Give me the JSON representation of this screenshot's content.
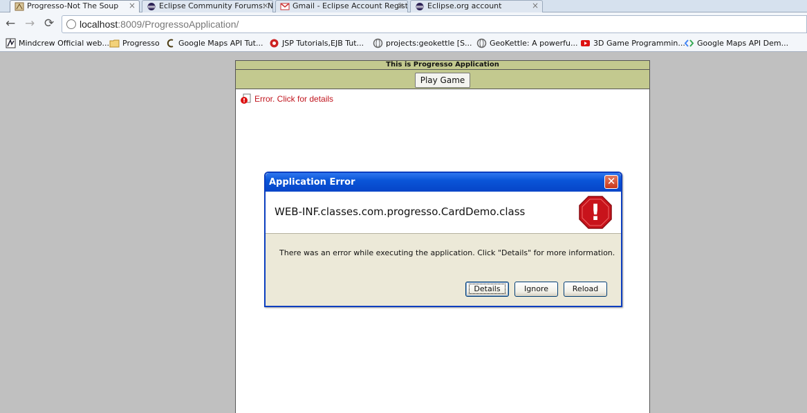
{
  "browser": {
    "tabs": [
      {
        "label": "Progresso-Not The Soup",
        "close": "×"
      },
      {
        "label": "Eclipse Community Forums: Ne",
        "close": "×"
      },
      {
        "label": "Gmail - Eclipse Account Registr",
        "close": "×"
      },
      {
        "label": "Eclipse.org account",
        "close": "×"
      }
    ],
    "nav": {
      "back": "←",
      "forward": "→",
      "reload": "⟳"
    },
    "url": {
      "host": "localhost",
      "rest": ":8009/ProgressoApplication/"
    },
    "bookmarks": [
      "Mindcrew Official web...",
      "Progresso",
      "Google Maps API Tut...",
      "JSP Tutorials,EJB Tut...",
      "projects:geokettle [S...",
      "GeoKettle: A powerfu...",
      "3D Game Programmin...",
      "Google Maps API Dem..."
    ]
  },
  "app": {
    "title": "This is Progresso Application",
    "play_button": "Play Game",
    "error_text": "Error.  Click for details"
  },
  "dialog": {
    "title": "Application Error",
    "close": "✕",
    "class_name": "WEB-INF.classes.com.progresso.CardDemo.class",
    "message": "There was an error while executing the application.  Click \"Details\" for more information.",
    "buttons": {
      "details": "Details",
      "ignore": "Ignore",
      "reload": "Reload"
    },
    "stop_glyph": "!"
  },
  "colors": {
    "app_header": "#c3c98f",
    "error_text": "#c0141d",
    "dialog_titlebar": "#0a55d8",
    "dialog_body": "#ece9d8"
  }
}
